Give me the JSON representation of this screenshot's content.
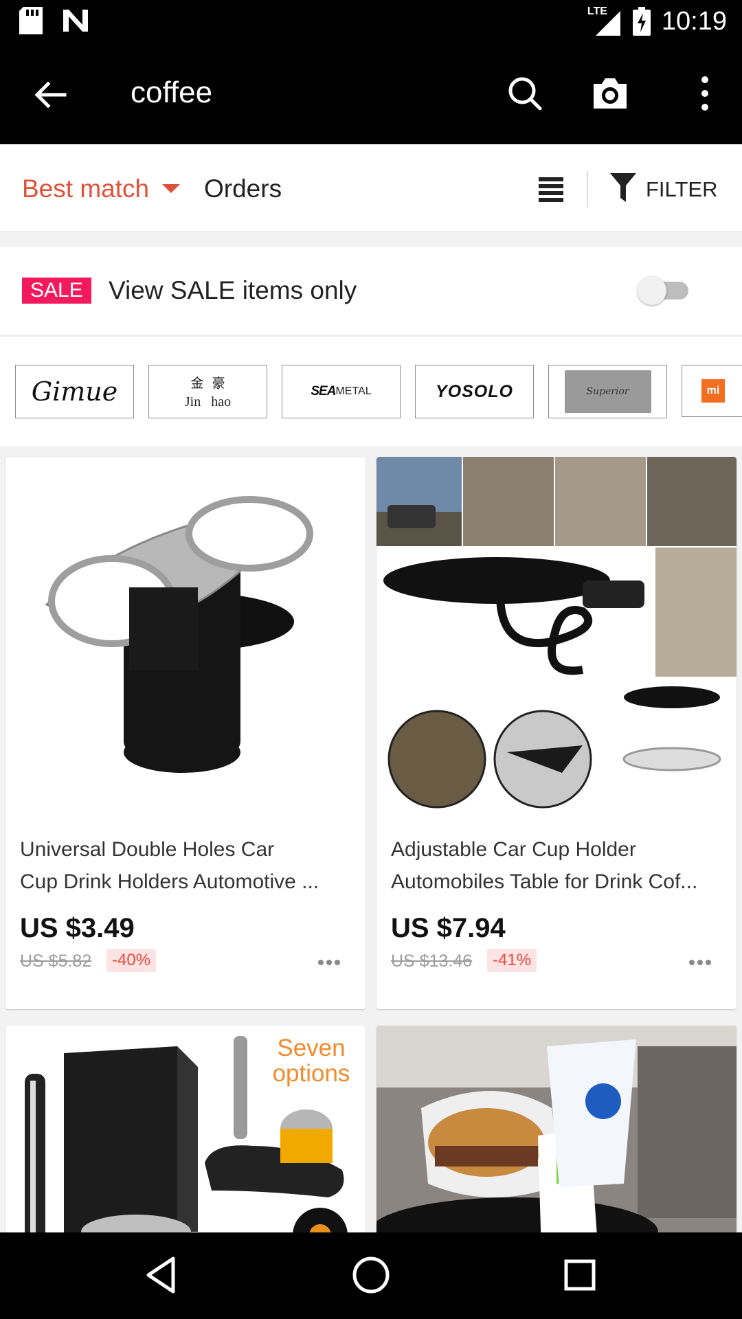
{
  "status_bar": {
    "time": "10:19",
    "network": "LTE"
  },
  "app_bar": {
    "search_query": "coffee"
  },
  "sort_bar": {
    "best_match": "Best match",
    "orders": "Orders",
    "filter": "FILTER"
  },
  "sale": {
    "badge": "SALE",
    "label": "View SALE items only",
    "toggle_on": false
  },
  "brands": [
    {
      "name": "Gimue"
    },
    {
      "name": "Jinhao",
      "cn": "金  豪",
      "latin": "Jin   hao"
    },
    {
      "name": "SEA METAL",
      "a": "SEA",
      "b": "METAL"
    },
    {
      "name": "YOSOLO"
    },
    {
      "name": "Superior"
    },
    {
      "name": "Xiaomi",
      "badge": "mi"
    }
  ],
  "products": [
    {
      "line1": "Universal Double Holes Car",
      "line2": "Cup Drink Holders Automotive ...",
      "price": "US $3.49",
      "old_price": "US $5.82",
      "discount": "-40%"
    },
    {
      "line1": "Adjustable Car Cup Holder",
      "line2": "Automobiles Table for Drink Cof...",
      "price": "US $7.94",
      "old_price": "US $13.46",
      "discount": "-41%"
    },
    {
      "overlay": "Seven options"
    },
    {}
  ],
  "colors": {
    "accent": "#e0513a",
    "sale_badge": "#f3195e",
    "discount_text": "#e64a3a"
  }
}
